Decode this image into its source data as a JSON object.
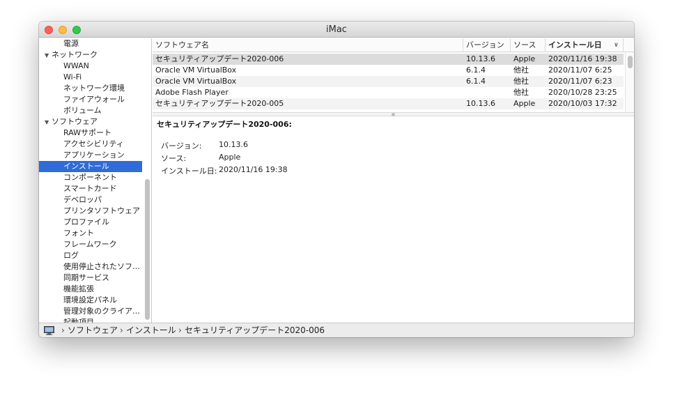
{
  "window": {
    "title": "iMac"
  },
  "sidebar": {
    "items": [
      {
        "label": "電源",
        "level": 2
      },
      {
        "label": "ネットワーク",
        "level": 1
      },
      {
        "label": "WWAN",
        "level": 2
      },
      {
        "label": "Wi-Fi",
        "level": 2
      },
      {
        "label": "ネットワーク環境",
        "level": 2
      },
      {
        "label": "ファイアウォール",
        "level": 2
      },
      {
        "label": "ボリューム",
        "level": 2
      },
      {
        "label": "ソフトウェア",
        "level": 1
      },
      {
        "label": "RAWサポート",
        "level": 2
      },
      {
        "label": "アクセシビリティ",
        "level": 2
      },
      {
        "label": "アプリケーション",
        "level": 2
      },
      {
        "label": "インストール",
        "level": 2
      },
      {
        "label": "コンポーネント",
        "level": 2
      },
      {
        "label": "スマートカード",
        "level": 2
      },
      {
        "label": "デベロッパ",
        "level": 2
      },
      {
        "label": "プリンタソフトウェア",
        "level": 2
      },
      {
        "label": "プロファイル",
        "level": 2
      },
      {
        "label": "フォント",
        "level": 2
      },
      {
        "label": "フレームワーク",
        "level": 2
      },
      {
        "label": "ログ",
        "level": 2
      },
      {
        "label": "使用停止されたソフ…",
        "level": 2
      },
      {
        "label": "同期サービス",
        "level": 2
      },
      {
        "label": "機能拡張",
        "level": 2
      },
      {
        "label": "環境設定パネル",
        "level": 2
      },
      {
        "label": "管理対象のクライア…",
        "level": 2
      },
      {
        "label": "起動項目",
        "level": 2
      }
    ],
    "expander_glyph": "▼",
    "selected_index": 11
  },
  "table": {
    "columns": [
      "ソフトウェア名",
      "バージョン",
      "ソース",
      "インストール日"
    ],
    "sort_icon": "∨",
    "rows": [
      [
        "セキュリティアップデート2020-006",
        "10.13.6",
        "Apple",
        "2020/11/16 19:38"
      ],
      [
        "Oracle VM VirtualBox",
        "6.1.4",
        "他社",
        "2020/11/07 6:25"
      ],
      [
        "Oracle VM VirtualBox",
        "6.1.4",
        "他社",
        "2020/11/07 6:23"
      ],
      [
        "Adobe Flash Player",
        "",
        "他社",
        "2020/10/28 23:25"
      ],
      [
        "セキュリティアップデート2020-005",
        "10.13.6",
        "Apple",
        "2020/10/03 17:32"
      ]
    ],
    "selected_row": 0
  },
  "detail": {
    "title": "セキュリティアップデート2020-006:",
    "fields": [
      {
        "label": "バージョン:",
        "value": "10.13.6"
      },
      {
        "label": "ソース:",
        "value": "Apple"
      },
      {
        "label": "インストール日:",
        "value": "2020/11/16 19:38"
      }
    ]
  },
  "pathbar": {
    "separator": "›",
    "crumbs": [
      "ソフトウェア",
      "インストール",
      "セキュリティアップデート2020-006"
    ]
  },
  "colors": {
    "selection": "#2f6cd9",
    "close": "#fc605c",
    "minimize": "#fdbc40",
    "zoom": "#34c84a"
  }
}
